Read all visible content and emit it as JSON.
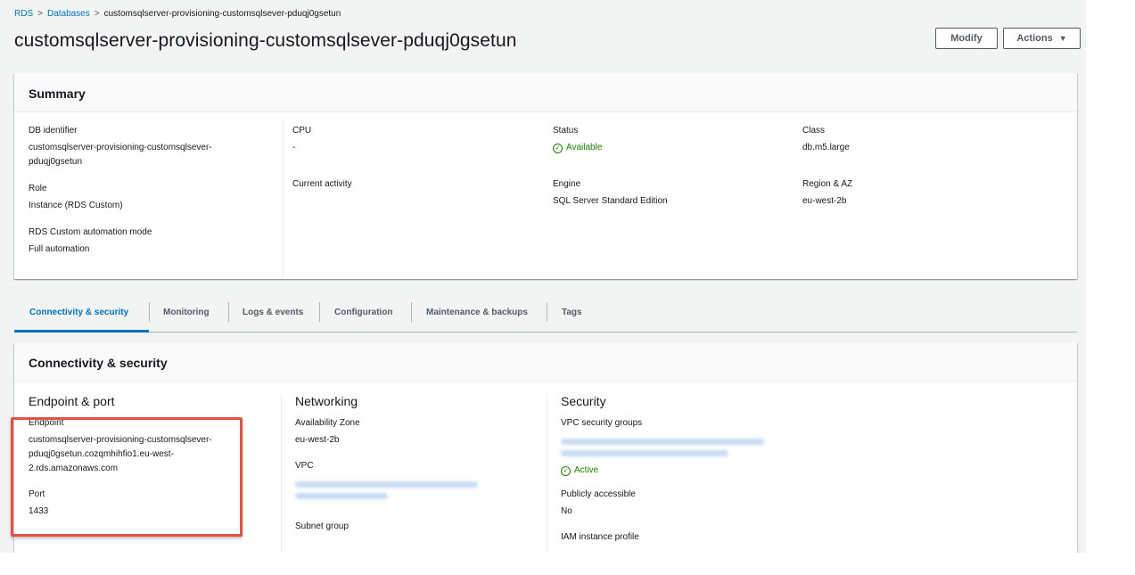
{
  "breadcrumb": {
    "rds": "RDS",
    "databases": "Databases",
    "current": "customsqlserver-provisioning-customsqlsever-pduqj0gsetun"
  },
  "page_title": "customsqlserver-provisioning-customsqlsever-pduqj0gsetun",
  "header_buttons": {
    "modify": "Modify",
    "actions": "Actions"
  },
  "summary": {
    "title": "Summary",
    "db_identifier": {
      "label": "DB identifier",
      "value_line1": "customsqlserver-provisioning-customsqlsever-",
      "value_line2": "pduqj0gsetun"
    },
    "role": {
      "label": "Role",
      "value": "Instance (RDS Custom)"
    },
    "automation_mode": {
      "label": "RDS Custom automation mode",
      "value": "Full automation"
    },
    "cpu": {
      "label": "CPU",
      "value": "-"
    },
    "current_activity": {
      "label": "Current activity"
    },
    "status": {
      "label": "Status",
      "value": "Available"
    },
    "engine": {
      "label": "Engine",
      "value": "SQL Server Standard Edition"
    },
    "class": {
      "label": "Class",
      "value": "db.m5.large"
    },
    "region_az": {
      "label": "Region & AZ",
      "value": "eu-west-2b"
    }
  },
  "tabs": [
    {
      "label": "Connectivity & security",
      "active": true
    },
    {
      "label": "Monitoring"
    },
    {
      "label": "Logs & events"
    },
    {
      "label": "Configuration"
    },
    {
      "label": "Maintenance & backups"
    },
    {
      "label": "Tags"
    }
  ],
  "connectivity": {
    "title": "Connectivity & security",
    "endpoint_port": {
      "heading": "Endpoint & port",
      "endpoint_label": "Endpoint",
      "endpoint_line1": "customsqlserver-provisioning-customsqlsever-",
      "endpoint_line2": "pduqj0gsetun.cozqmhihfio1.eu-west-",
      "endpoint_line3": "2.rds.amazonaws.com",
      "port_label": "Port",
      "port_value": "1433"
    },
    "networking": {
      "heading": "Networking",
      "az_label": "Availability Zone",
      "az_value": "eu-west-2b",
      "vpc_label": "VPC",
      "subnet_label": "Subnet group"
    },
    "security": {
      "heading": "Security",
      "vpc_sg_label": "VPC security groups",
      "sg_status": "Active",
      "public_label": "Publicly accessible",
      "public_value": "No",
      "iam_label": "IAM instance profile"
    }
  },
  "colors": {
    "link": "#0073bb",
    "success": "#1d8102",
    "highlight": "#e05243",
    "background": "#f2f3f3"
  }
}
